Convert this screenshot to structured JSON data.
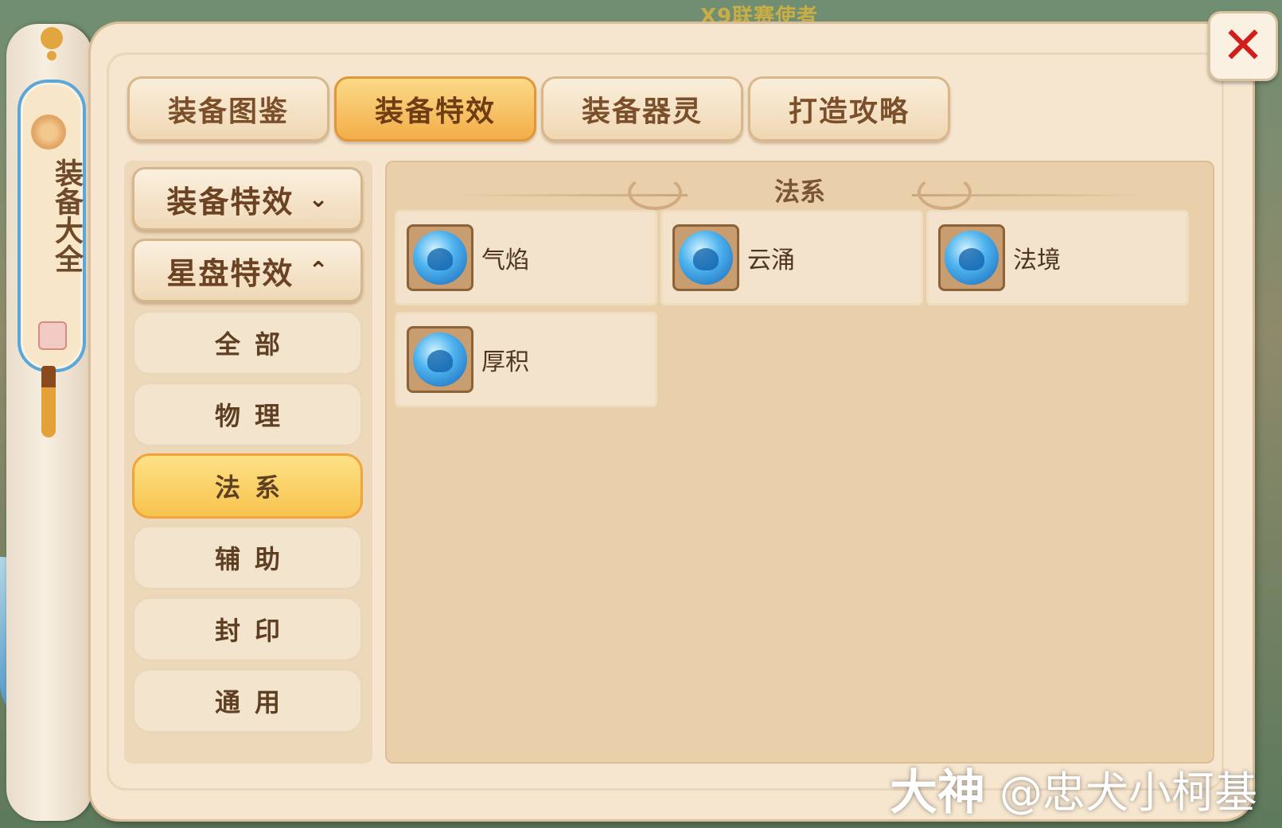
{
  "background_banner": "X9联赛使者",
  "scroll": {
    "title": "装备大全"
  },
  "close": {
    "symbol": "✕"
  },
  "tabs": [
    {
      "label": "装备图鉴",
      "active": false
    },
    {
      "label": "装备特效",
      "active": true
    },
    {
      "label": "装备器灵",
      "active": false
    },
    {
      "label": "打造攻略",
      "active": false
    }
  ],
  "side_menu": {
    "categories": [
      {
        "label": "装备特效",
        "chevron": "chevron-down-icon",
        "glyph": "⌄"
      },
      {
        "label": "星盘特效",
        "chevron": "chevron-up-icon",
        "glyph": "⌃"
      }
    ],
    "subitems": [
      {
        "label": "全部",
        "active": false
      },
      {
        "label": "物理",
        "active": false
      },
      {
        "label": "法系",
        "active": true
      },
      {
        "label": "辅助",
        "active": false
      },
      {
        "label": "封印",
        "active": false
      },
      {
        "label": "通用",
        "active": false
      }
    ]
  },
  "content": {
    "section_title": "法系",
    "items": [
      {
        "name": "气焰",
        "icon": "blue-spirit-icon"
      },
      {
        "name": "云涌",
        "icon": "blue-spirit-icon"
      },
      {
        "name": "法境",
        "icon": "blue-spirit-icon"
      },
      {
        "name": "厚积",
        "icon": "blue-flame-spirit-icon"
      }
    ]
  },
  "watermark": {
    "logo": "大神",
    "user": "@忠犬小柯基"
  },
  "colors": {
    "accent": "#f3ae49",
    "close_x": "#d11e1a",
    "panel": "#f6e6cf"
  }
}
